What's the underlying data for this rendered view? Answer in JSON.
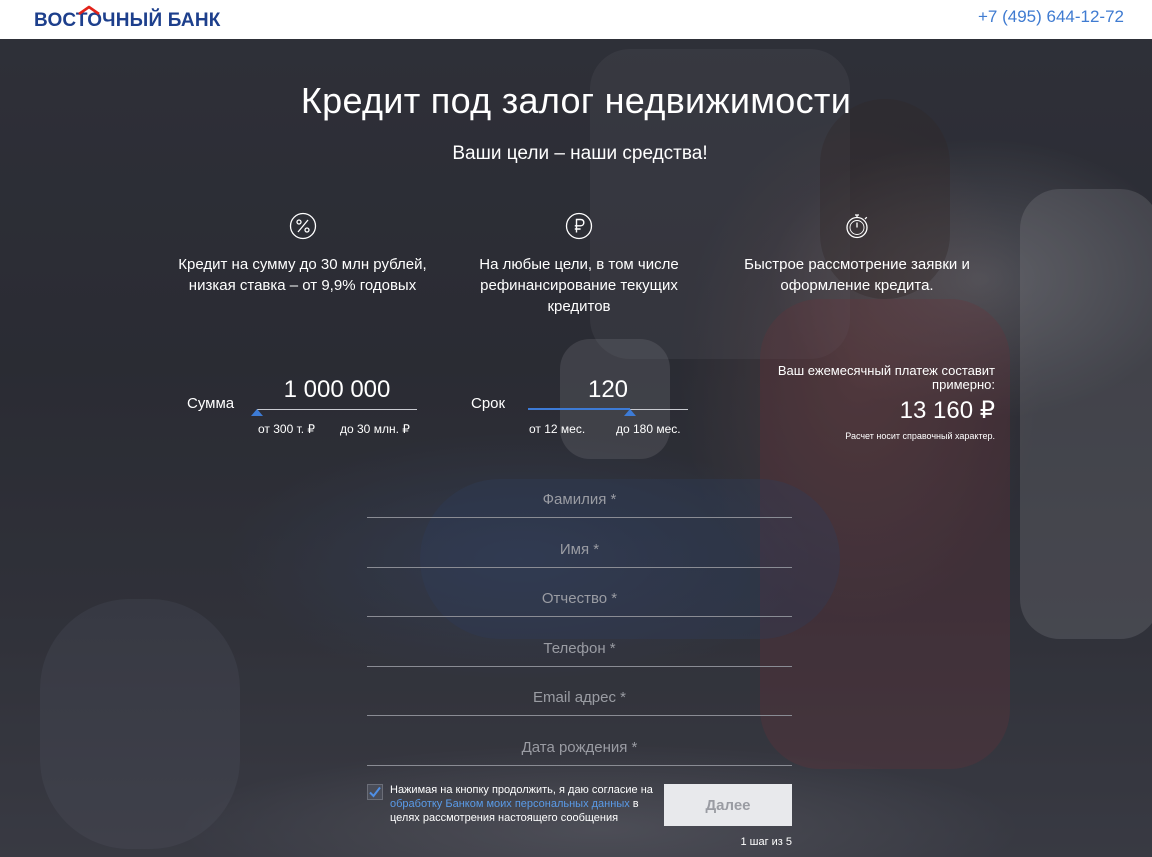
{
  "header": {
    "logo_text": "ВОСТОЧНЫЙ БАНК",
    "phone": "+7 (495) 644-12-72"
  },
  "hero": {
    "title": "Кредит под залог недвижимости",
    "subtitle": "Ваши цели – наши средства!"
  },
  "features": [
    {
      "icon": "percent-icon",
      "line1": "Кредит на сумму до 30 млн рублей,",
      "line2": "низкая ставка – от 9,9% годовых",
      "line3": ""
    },
    {
      "icon": "ruble-icon",
      "line1": "На любые цели, в том числе",
      "line2": "рефинансирование текущих",
      "line3": "кредитов"
    },
    {
      "icon": "stopwatch-icon",
      "line1": "Быстрое рассмотрение заявки и",
      "line2": "оформление кредита.",
      "line3": ""
    }
  ],
  "calculator": {
    "amount": {
      "label": "Сумма",
      "value": "1 000 000",
      "min_label": "от 300 т. ₽",
      "max_label": "до 30 млн. ₽",
      "slider_fraction": 0.0
    },
    "term": {
      "label": "Срок",
      "value": "120",
      "min_label": "от 12 мес.",
      "max_label": "до 180 мес.",
      "slider_fraction": 0.64
    },
    "payment": {
      "caption_line1": "Ваш ежемесячный платеж составит",
      "caption_line2": "примерно:",
      "value": "13 160 ₽",
      "note": "Расчет носит справочный характер."
    }
  },
  "form": {
    "fields": [
      {
        "name": "surname",
        "placeholder": "Фамилия *",
        "value": ""
      },
      {
        "name": "first-name",
        "placeholder": "Имя *",
        "value": ""
      },
      {
        "name": "patronymic",
        "placeholder": "Отчество *",
        "value": ""
      },
      {
        "name": "phone",
        "placeholder": "Телефон *",
        "value": ""
      },
      {
        "name": "email",
        "placeholder": "Email адрес *",
        "value": ""
      },
      {
        "name": "birth-date",
        "placeholder": "Дата рождения *",
        "value": ""
      }
    ],
    "consent_checked": true,
    "consent_before": "Нажимая на кнопку продолжить, я даю согласие на",
    "consent_link": "обработку Банком моих персональных данных",
    "consent_after_link": " в",
    "consent_tail": "целях рассмотрения настоящего сообщения",
    "next_label": "Далее",
    "step_label": "1 шаг из 5"
  },
  "colors": {
    "brand": "#1d3f8c",
    "accent": "#3d7bd6",
    "link": "#5a9be8"
  }
}
